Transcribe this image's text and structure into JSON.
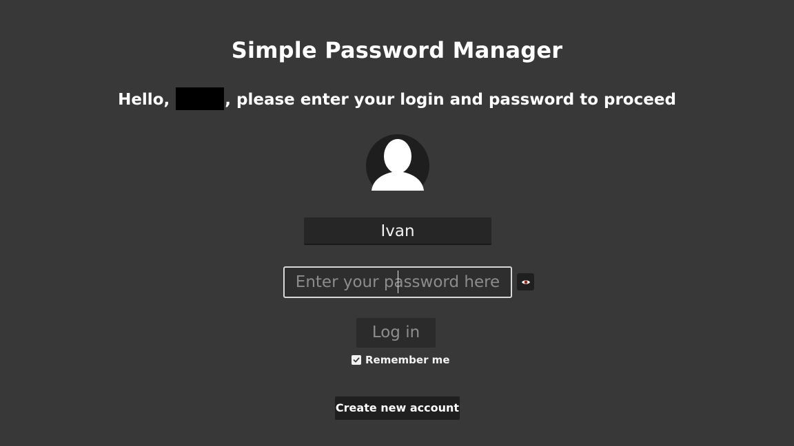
{
  "app": {
    "title": "Simple Password Manager"
  },
  "greeting": {
    "prefix": "Hello,",
    "suffix": ", please enter your login and password to proceed"
  },
  "login": {
    "username": "Ivan",
    "password_value": "",
    "password_placeholder": "Enter your password here",
    "show_password_icon": "eye-icon",
    "submit_label": "Log in",
    "remember_label": "Remember me",
    "remember_checked": true,
    "create_account_label": "Create new account"
  },
  "icons": {
    "avatar": "user-silhouette-icon",
    "checkbox": "checkmark-icon"
  },
  "colors": {
    "background": "#383838",
    "panel_dark": "#262626",
    "text": "#ffffff",
    "placeholder": "#8c8c8c",
    "eye_iris": "#c0392b"
  }
}
